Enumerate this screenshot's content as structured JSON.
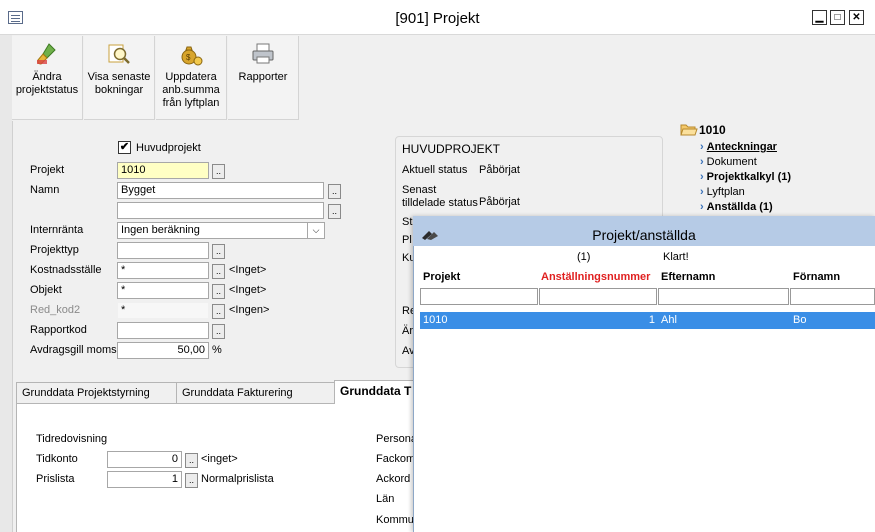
{
  "window": {
    "title": "[901]  Projekt",
    "minimize": "▁",
    "maximize": "□",
    "close": "✕"
  },
  "toolbar": {
    "buttons": [
      {
        "label": "Ändra\nprojektstatus",
        "icon": "brush-icon"
      },
      {
        "label": "Visa senaste\nbokningar",
        "icon": "magnifier-icon"
      },
      {
        "label": "Uppdatera\nanb.summa\nfrån lyftplan",
        "icon": "money-bag-icon"
      },
      {
        "label": "Rapporter",
        "icon": "printer-icon"
      }
    ]
  },
  "form": {
    "huvudprojekt_label": "Huvudprojekt",
    "huvudprojekt_checked": true,
    "fields": {
      "projekt": {
        "label": "Projekt",
        "value": "1010"
      },
      "namn": {
        "label": "Namn",
        "value": "Bygget",
        "value2": ""
      },
      "internranta": {
        "label": "Internränta",
        "value": "Ingen beräkning"
      },
      "projekttyp": {
        "label": "Projekttyp",
        "value": ""
      },
      "kostnadsstalle": {
        "label": "Kostnadsställe",
        "value": "*",
        "note": "<Inget>"
      },
      "objekt": {
        "label": "Objekt",
        "value": "*",
        "note": "<Inget>"
      },
      "red_kod2": {
        "label": "Red_kod2",
        "value": "*",
        "note": "<Ingen>"
      },
      "rapportkod": {
        "label": "Rapportkod",
        "value": ""
      },
      "avdragsgill_moms": {
        "label": "Avdragsgill moms",
        "value": "50,00",
        "unit": "%"
      }
    },
    "dots": ".."
  },
  "huvudprojekt_box": {
    "title": "HUVUDPROJEKT",
    "aktuell_status_label": "Aktuell status",
    "aktuell_status_value": "Påbörjat",
    "senast_label": "Senast\ntilldelade status",
    "senast_value": "Påbörjat",
    "partial_labels": [
      "St",
      "Pl",
      "Ku"
    ],
    "partial_right": [
      "Re",
      "Är",
      "Av"
    ]
  },
  "tree": {
    "root": "1010",
    "items": [
      {
        "label": "Anteckningar",
        "bold": true,
        "underline": true
      },
      {
        "label": "Dokument",
        "bold": false
      },
      {
        "label": "Projektkalkyl (1)",
        "bold": true
      },
      {
        "label": "Lyftplan",
        "bold": false
      },
      {
        "label": "Anställda (1)",
        "bold": true
      }
    ]
  },
  "tabs": [
    {
      "label": "Grunddata Projektstyrning"
    },
    {
      "label": "Grunddata Fakturering"
    },
    {
      "label": "Grunddata T"
    }
  ],
  "tab_panel": {
    "tidredovisning": "Tidredovisning",
    "tidkonto_label": "Tidkonto",
    "tidkonto_value": "0",
    "tidkonto_note": "<inget>",
    "prislista_label": "Prislista",
    "prislista_value": "1",
    "prislista_note": "Normalprislista",
    "right_labels": [
      "Persona",
      "Fackom",
      "Ackord",
      "Län",
      "Kommu"
    ]
  },
  "popup": {
    "title": "Projekt/anställda",
    "count": "(1)",
    "status": "Klart!",
    "columns": [
      {
        "label": "Projekt",
        "color": "#000000"
      },
      {
        "label": "Anställningsnummer",
        "color": "#e02020"
      },
      {
        "label": "Efternamn",
        "color": "#000000"
      },
      {
        "label": "Förnamn",
        "color": "#000000"
      }
    ],
    "rows": [
      {
        "projekt": "1010",
        "anstallningsnummer": "1",
        "efternamn": "Ahl",
        "fornamn": "Bo"
      }
    ]
  }
}
